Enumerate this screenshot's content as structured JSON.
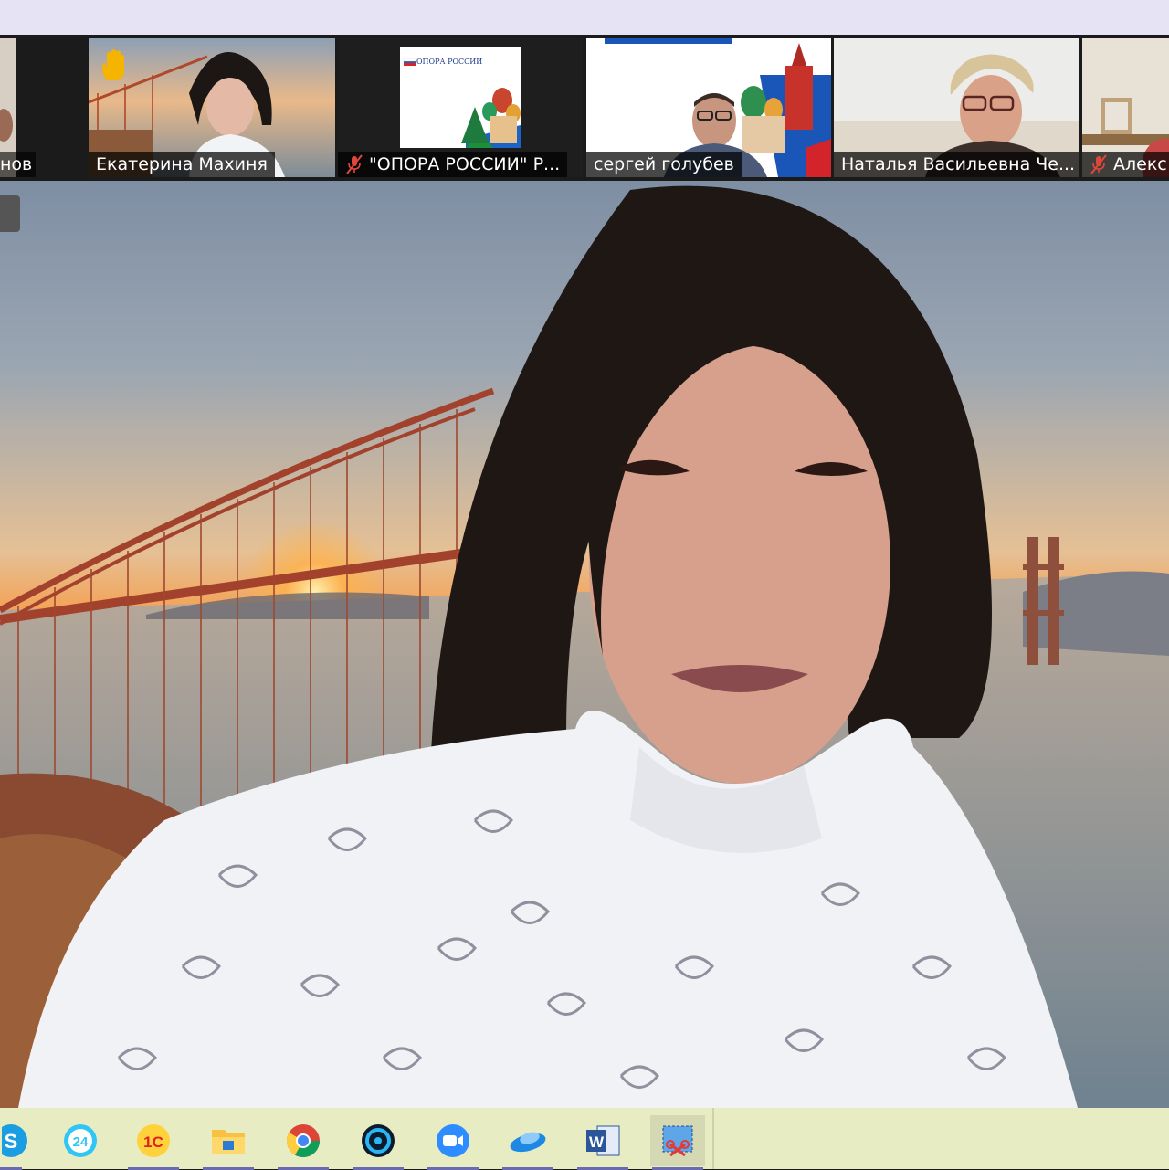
{
  "participants": [
    {
      "name": "нов",
      "muted": false
    },
    {
      "name": "Екатерина Махиня",
      "muted": false,
      "hand_raised": true,
      "active_speaker": true
    },
    {
      "name": "\"ОПОРА РОССИИ\" Р...",
      "muted": true,
      "slide_caption": "ОПОРА РОССИИ"
    },
    {
      "name": "сергей голубев",
      "muted": false
    },
    {
      "name": "Наталья Васильевна Че...",
      "muted": false
    },
    {
      "name": "Алекс",
      "muted": true
    }
  ],
  "main_speaker": {
    "name": "Екатерина Махиня",
    "background": "golden-gate-bridge-sunset"
  },
  "taskbar": {
    "apps": [
      {
        "icon": "skype-icon",
        "label": "S"
      },
      {
        "icon": "bitrix24-icon",
        "label": "24"
      },
      {
        "icon": "1c-icon",
        "label": "1С"
      },
      {
        "icon": "file-explorer-icon"
      },
      {
        "icon": "chrome-icon"
      },
      {
        "icon": "camera-app-icon"
      },
      {
        "icon": "zoom-icon"
      },
      {
        "icon": "cloud-app-icon"
      },
      {
        "icon": "word-icon",
        "label": "W"
      },
      {
        "icon": "snipping-tool-icon",
        "active": true
      }
    ]
  },
  "colors": {
    "active_border": "#c9cf39",
    "taskbar_bg": "#e8ecc3",
    "top_band": "#e6e3f5",
    "mute_red": "#e0463a"
  }
}
